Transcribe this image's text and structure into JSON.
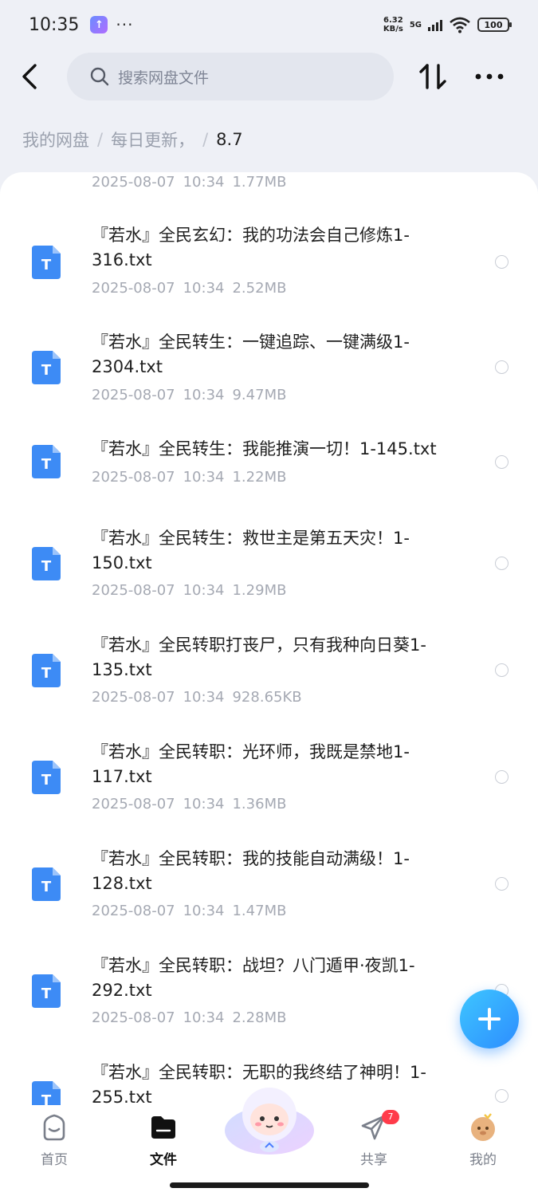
{
  "status_bar": {
    "time": "10:35",
    "app_icon_glyph": "↑",
    "dots": "···",
    "net_speed_value": "6.32",
    "net_speed_unit": "KB/s",
    "signal_label": "5G",
    "battery": "100"
  },
  "header": {
    "search_placeholder": "搜索网盘文件"
  },
  "breadcrumb": {
    "items": [
      "我的网盘",
      "每日更新，"
    ],
    "current": "8.7",
    "separator": "/"
  },
  "files": [
    {
      "name": "",
      "date": "2025-08-07",
      "time": "10:34",
      "size": "1.77MB"
    },
    {
      "name": "『若水』全民玄幻：我的功法会自己修炼1-316.txt",
      "date": "2025-08-07",
      "time": "10:34",
      "size": "2.52MB"
    },
    {
      "name": "『若水』全民转生：一键追踪、一键满级1-2304.txt",
      "date": "2025-08-07",
      "time": "10:34",
      "size": "9.47MB"
    },
    {
      "name": "『若水』全民转生：我能推演一切！1-145.txt",
      "date": "2025-08-07",
      "time": "10:34",
      "size": "1.22MB"
    },
    {
      "name": "『若水』全民转生：救世主是第五天灾！1-150.txt",
      "date": "2025-08-07",
      "time": "10:34",
      "size": "1.29MB"
    },
    {
      "name": "『若水』全民转职打丧尸，只有我种向日葵1-135.txt",
      "date": "2025-08-07",
      "time": "10:34",
      "size": "928.65KB"
    },
    {
      "name": "『若水』全民转职：光环师，我既是禁地1-117.txt",
      "date": "2025-08-07",
      "time": "10:34",
      "size": "1.36MB"
    },
    {
      "name": "『若水』全民转职：我的技能自动满级！1-128.txt",
      "date": "2025-08-07",
      "time": "10:34",
      "size": "1.47MB"
    },
    {
      "name": "『若水』全民转职：战坦？八门遁甲·夜凯1-292.txt",
      "date": "2025-08-07",
      "time": "10:34",
      "size": "2.28MB"
    },
    {
      "name": "『若水』全民转职：无职的我终结了神明！1-255.txt",
      "date": "",
      "time": "",
      "size": ""
    }
  ],
  "file_icon_letter": "T",
  "nav": {
    "home": "首页",
    "files": "文件",
    "share": "共享",
    "share_badge": "7",
    "mine": "我的"
  },
  "colors": {
    "accent": "#2d8dff",
    "file_icon": "#3d8bf5",
    "badge": "#ff3b4a"
  },
  "icons": [
    "back-arrow-icon",
    "search-icon",
    "sort-icon",
    "more-icon",
    "text-file-icon",
    "plus-icon",
    "home-icon",
    "folder-icon",
    "share-icon",
    "avatar-icon",
    "mascot-icon"
  ]
}
